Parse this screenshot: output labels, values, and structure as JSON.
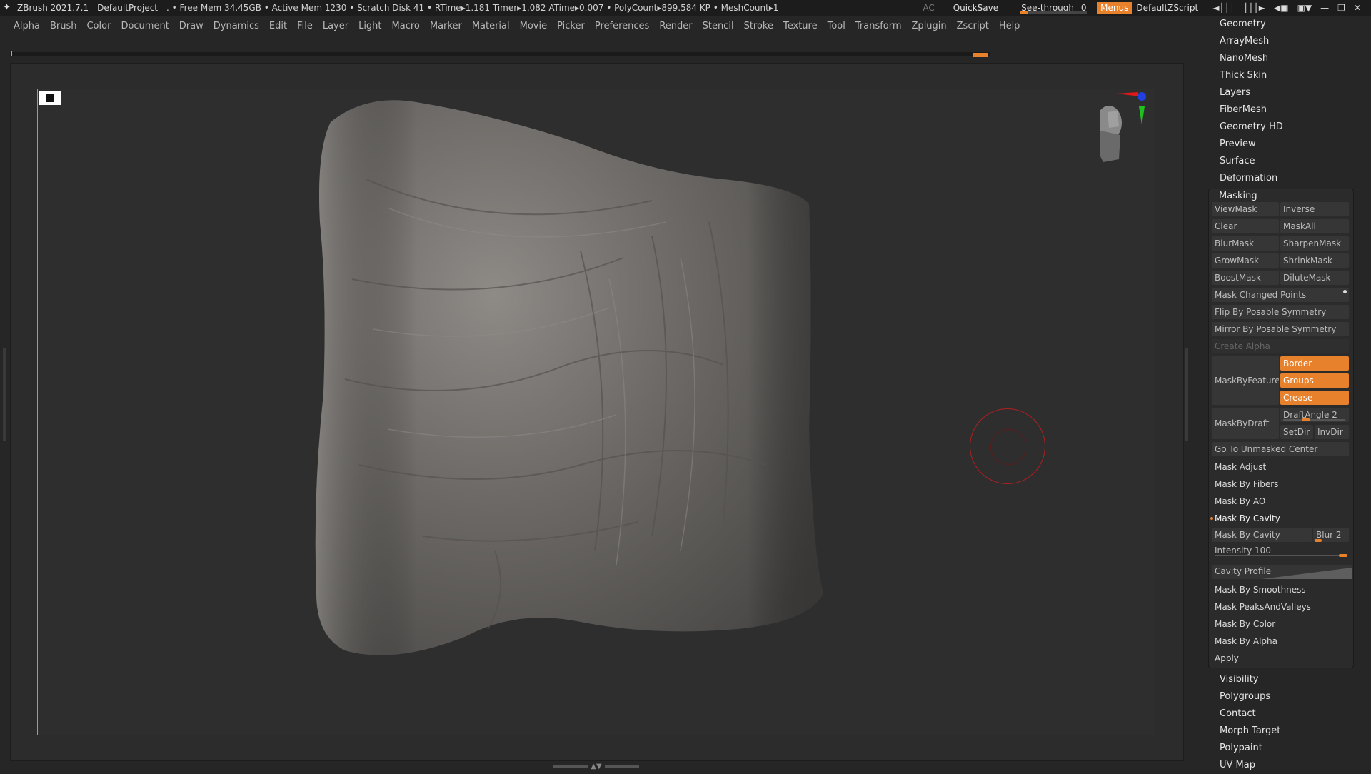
{
  "titlebar": {
    "app": "ZBrush 2021.7.1",
    "project": "DefaultProject",
    "stats": ". • Free Mem 34.45GB • Active Mem 1230 • Scratch Disk 41 •  RTime▸1.181 Timer▸1.082 ATime▸0.007 • PolyCount▸899.584 KP  • MeshCount▸1",
    "ac": "AC",
    "quicksave": "QuickSave",
    "see_through_label": "See-through",
    "see_through_value": "0",
    "menus": "Menus",
    "default_script": "DefaultZScript"
  },
  "menubar": [
    "Alpha",
    "Brush",
    "Color",
    "Document",
    "Draw",
    "Dynamics",
    "Edit",
    "File",
    "Layer",
    "Light",
    "Macro",
    "Marker",
    "Material",
    "Movie",
    "Picker",
    "Preferences",
    "Render",
    "Stencil",
    "Stroke",
    "Texture",
    "Tool",
    "Transform",
    "Zplugin",
    "Zscript",
    "Help"
  ],
  "tool_sections_top": [
    "Geometry",
    "ArrayMesh",
    "NanoMesh",
    "Thick Skin",
    "Layers",
    "FiberMesh",
    "Geometry HD",
    "Preview",
    "Surface",
    "Deformation"
  ],
  "masking": {
    "title": "Masking",
    "viewmask": "ViewMask",
    "inverse": "Inverse",
    "clear": "Clear",
    "maskall": "MaskAll",
    "blurmask": "BlurMask",
    "sharpenmask": "SharpenMask",
    "growmask": "GrowMask",
    "shrinkmask": "ShrinkMask",
    "boostmask": "BoostMask",
    "dilutemask": "DiluteMask",
    "mask_changed_points": "Mask Changed Points",
    "flip_posable": "Flip By Posable Symmetry",
    "mirror_posable": "Mirror By Posable Symmetry",
    "create_alpha": "Create Alpha",
    "maskbyfeature": "MaskByFeature",
    "border": "Border",
    "groups": "Groups",
    "crease": "Crease",
    "maskbydraft": "MaskByDraft",
    "draftangle": "DraftAngle 2",
    "draftangle_level": 0.3,
    "setdir": "SetDir",
    "invdir": "InvDir",
    "goto_unmasked": "Go To Unmasked Center",
    "mask_adjust": "Mask Adjust",
    "mask_by_fibers": "Mask By Fibers",
    "mask_by_ao": "Mask By AO",
    "mask_by_cavity_header": "Mask By Cavity",
    "mask_by_cavity_btn": "Mask By Cavity",
    "blur": "Blur 2",
    "blur_level": 0.2,
    "intensity": "Intensity 100",
    "intensity_level": 1.0,
    "cavity_profile": "Cavity Profile",
    "mask_by_smoothness": "Mask By Smoothness",
    "mask_peaks_valleys": "Mask PeaksAndValleys",
    "mask_by_color": "Mask By Color",
    "mask_by_alpha": "Mask By Alpha",
    "apply": "Apply"
  },
  "tool_sections_bottom": [
    "Visibility",
    "Polygroups",
    "Contact",
    "Morph Target",
    "Polypaint",
    "UV Map"
  ],
  "colors": {
    "accent": "#e8812c",
    "brush_ring": "#b02020"
  }
}
